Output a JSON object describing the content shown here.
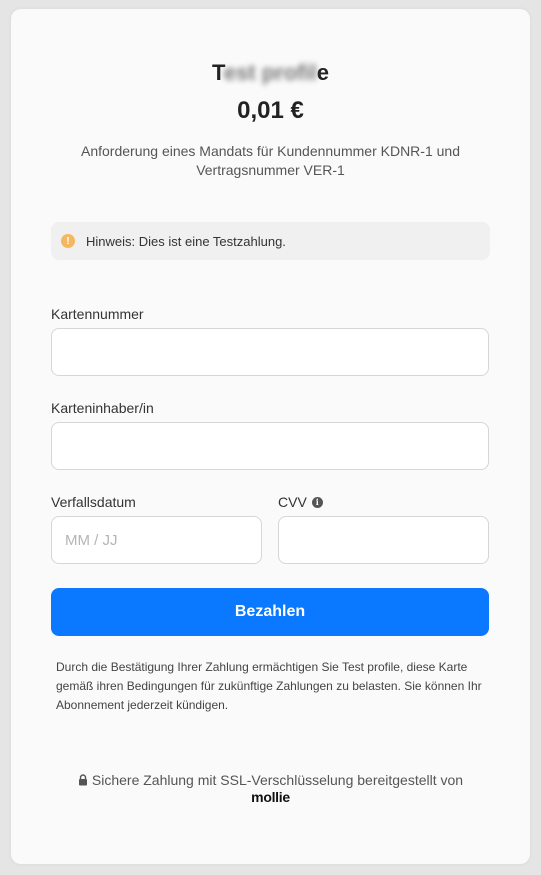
{
  "header": {
    "merchant_first": "T",
    "merchant_blurred": "est profil",
    "merchant_last": "e",
    "amount": "0,01 €",
    "description": "Anforderung eines Mandats für Kundennummer KDNR-1 und Vertragsnummer VER-1"
  },
  "notice": {
    "icon": "warning-icon",
    "text": "Hinweis: Dies ist eine Testzahlung."
  },
  "form": {
    "card_number_label": "Kartennummer",
    "card_holder_label": "Karteninhaber/in",
    "expiry_label": "Verfallsdatum",
    "expiry_placeholder": "MM / JJ",
    "cvv_label": "CVV",
    "cvv_info_icon": "info-icon"
  },
  "actions": {
    "pay_label": "Bezahlen"
  },
  "footer": {
    "consent": "Durch die Bestätigung Ihrer Zahlung ermächtigen Sie Test profile, diese Karte gemäß ihren Bedingungen für zukünftige Zahlungen zu belasten. Sie können Ihr Abonnement jederzeit kündigen.",
    "ssl_text": "Sichere Zahlung mit SSL-Verschlüsselung bereitgestellt von",
    "provider": "mollie"
  },
  "colors": {
    "accent": "#0a78ff",
    "notice_icon": "#f4b860",
    "background": "#e5e5e5",
    "card": "#fafafa"
  }
}
